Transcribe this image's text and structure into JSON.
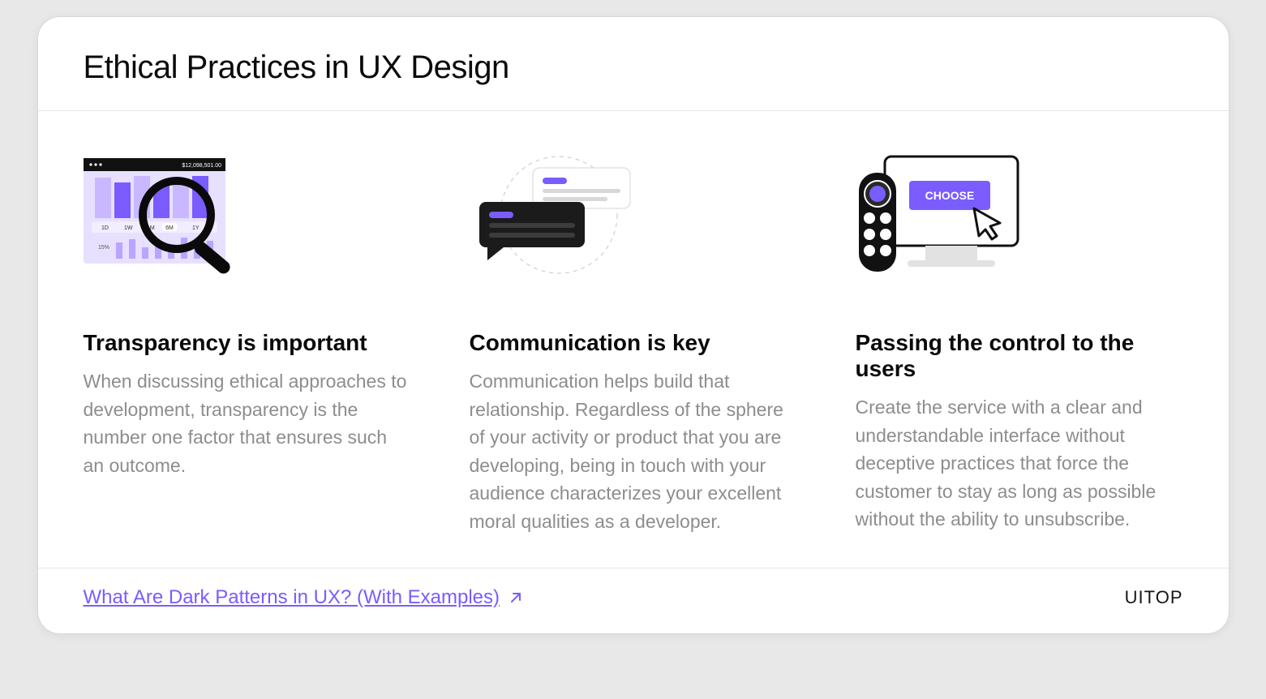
{
  "title": "Ethical Practices in UX Design",
  "columns": [
    {
      "icon": "magnifier-chart-icon",
      "heading": "Transparency is important",
      "text": "When discussing ethical approaches to development, transparency is the number one factor that ensures such an outcome."
    },
    {
      "icon": "chat-bubbles-icon",
      "heading": "Communication is key",
      "text": "Communication helps build that relationship. Regardless of the sphere of your activity or product that you are developing, being in touch with your audience characterizes your excellent moral qualities as a developer."
    },
    {
      "icon": "remote-monitor-icon",
      "heading": "Passing the control to the users",
      "text": "Create the service with a clear and understandable interface without deceptive practices that force the customer to stay as long as possible without the ability to unsubscribe."
    }
  ],
  "illustration_labels": {
    "chart_amount": "$12,098,501.00",
    "chart_tabs": [
      "1D",
      "1W",
      "1M",
      "6M",
      "1Y"
    ],
    "chart_pct": "15%",
    "choose_button": "CHOOSE"
  },
  "footer": {
    "link_text": "What Are Dark Patterns in UX? (With Examples)",
    "brand": "UITOP"
  }
}
